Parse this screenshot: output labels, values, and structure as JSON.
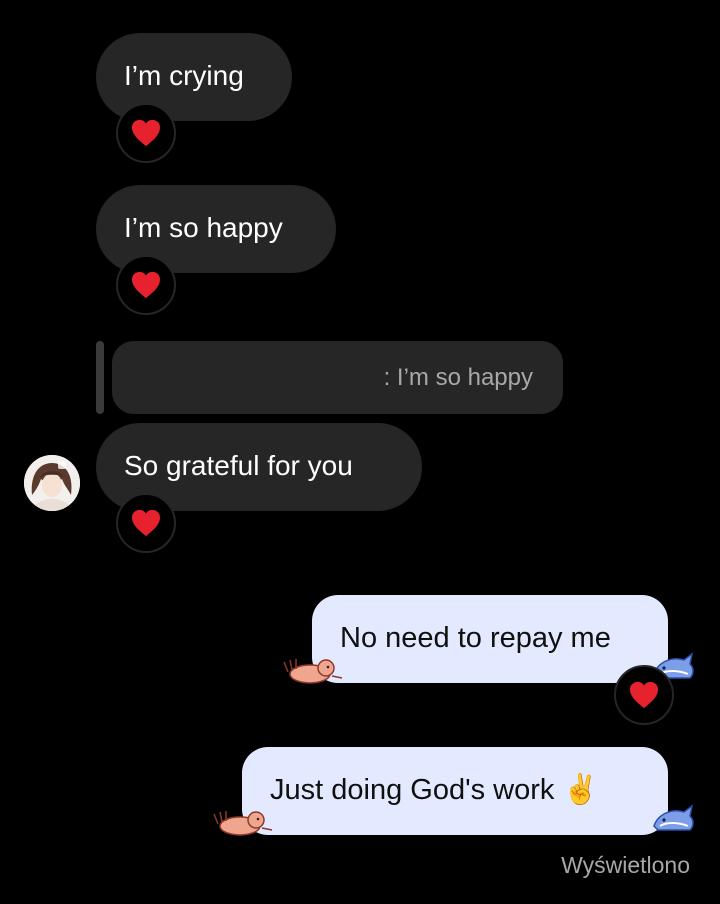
{
  "messages": {
    "incoming": [
      {
        "text": "I’m crying",
        "reaction": "red-heart"
      },
      {
        "text": "I’m so happy",
        "reaction": "red-heart"
      },
      {
        "text": "So grateful for you",
        "reaction": "red-heart"
      }
    ],
    "reply_preview": {
      "text": ": I’m so happy"
    },
    "outgoing": [
      {
        "text": "No need to repay me",
        "reaction": "red-heart"
      },
      {
        "text": "Just doing God's work ✌️"
      }
    ]
  },
  "status": {
    "seen_label": "Wyświetlono"
  },
  "colors": {
    "background": "#000000",
    "incoming_bubble": "#262626",
    "outgoing_bubble": "#e3eaff",
    "heart": "#e8212f",
    "status_text": "#a8a8a8"
  },
  "icons": [
    "red-heart-icon",
    "avatar",
    "cat-sticker-icon",
    "shark-sticker-icon"
  ]
}
